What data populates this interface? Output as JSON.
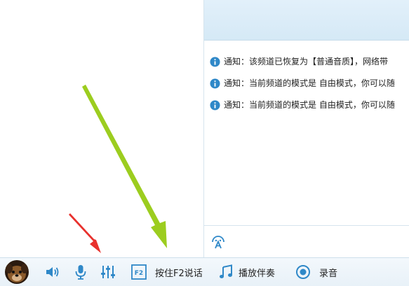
{
  "notices": [
    {
      "label": "通知：",
      "text": "该频道已恢复为【普通音质】，网络带"
    },
    {
      "label": "通知：",
      "text": "当前频道的模式是 自由模式，你可以随"
    },
    {
      "label": "通知：",
      "text": "当前频道的模式是 自由模式，你可以随"
    }
  ],
  "toolbar": {
    "speaker_icon": "speaker-icon",
    "mic_icon": "microphone-icon",
    "mixer_icon": "mixer-settings-icon",
    "f2_icon_text": "F2",
    "push_to_talk_label": "按住F2说话",
    "play_accompaniment_label": "播放伴奏",
    "record_label": "录音"
  },
  "colors": {
    "accent": "#2f88c8",
    "red_arrow": "#e8312d",
    "green_arrow": "#9ccd1f"
  }
}
